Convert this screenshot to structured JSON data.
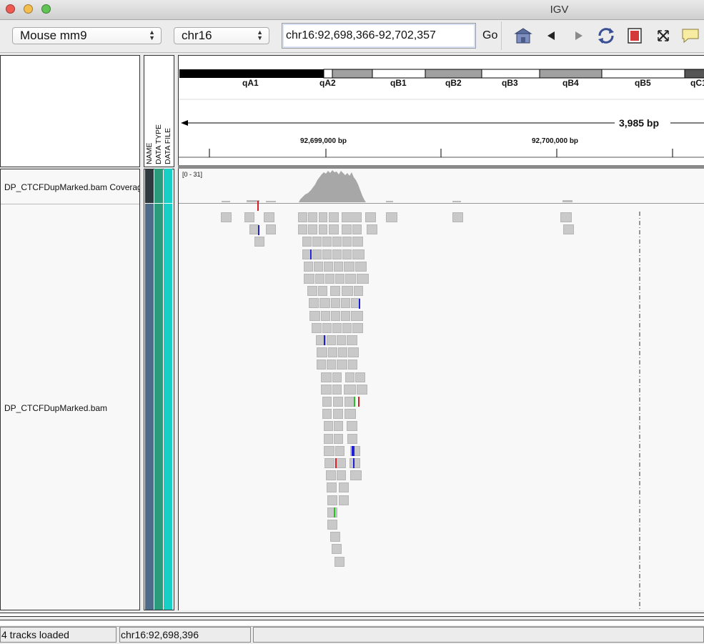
{
  "window": {
    "title": "IGV"
  },
  "toolbar": {
    "genome": "Mouse mm9",
    "chromosome": "chr16",
    "locus": "chr16:92,698,366-92,702,357",
    "go_label": "Go"
  },
  "attribute_headers": [
    "NAME",
    "DATA TYPE",
    "DATA FILE"
  ],
  "ideogram": {
    "bands": [
      "qA1",
      "qA2",
      "qB1",
      "qB2",
      "qB3",
      "qB4",
      "qB5",
      "qC1"
    ]
  },
  "ruler": {
    "span_label": "3,985 bp",
    "tick_labels": [
      "92,699,000 bp",
      "92,700,000 bp"
    ]
  },
  "tracks": {
    "coverage": {
      "name": "DP_CTCFDupMarked.bam Coverage",
      "range": "[0 - 31]"
    },
    "alignment": {
      "name": "DP_CTCFDupMarked.bam"
    }
  },
  "status": {
    "tracks_loaded": "4 tracks loaded",
    "position": "chr16:92,698,396"
  },
  "colors": {
    "name_attr": "#4f6b8a",
    "type_attr": "#2a9c7c",
    "file_attr": "#17cfc4",
    "mismatch_blue": "#1f1fd6",
    "mismatch_red": "#d42020",
    "mismatch_green": "#22c422"
  }
}
